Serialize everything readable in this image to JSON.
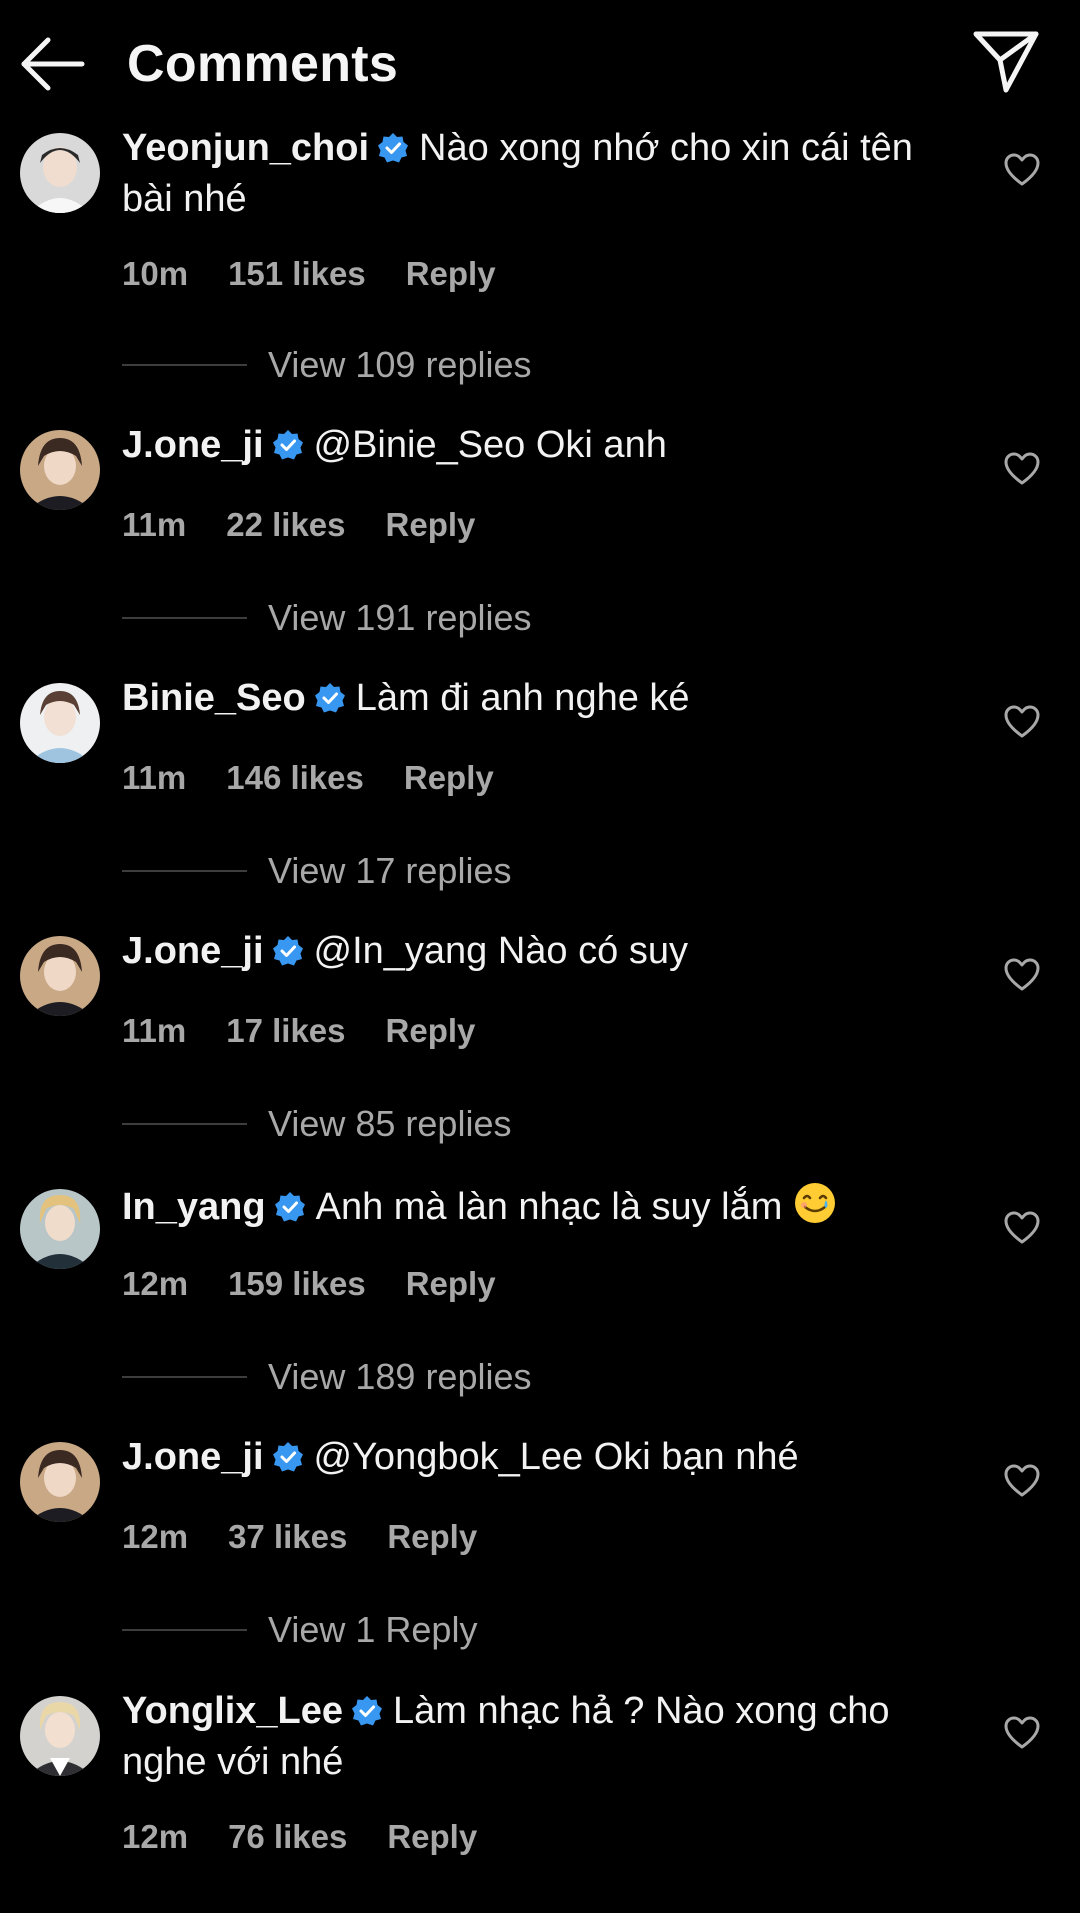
{
  "header": {
    "title": "Comments"
  },
  "colors": {
    "background": "#000000",
    "verified": "#3897f0",
    "muted": "#a8a8a8",
    "text": "#f5f5f5"
  },
  "comments": [
    {
      "username": "Yeonjun_choi",
      "text": "Nào xong nhớ cho xin cái tên bài nhé",
      "time": "10m",
      "likes": "151 likes",
      "reply": "Reply",
      "view_replies": "View 109 replies",
      "avatar_icon": "avatar-yeonjun"
    },
    {
      "username": "J.one_ji",
      "text": "@Binie_Seo Oki anh",
      "time": "11m",
      "likes": "22 likes",
      "reply": "Reply",
      "view_replies": "View 191 replies",
      "avatar_icon": "avatar-jone"
    },
    {
      "username": "Binie_Seo",
      "text": "Làm đi anh nghe ké",
      "time": "11m",
      "likes": "146 likes",
      "reply": "Reply",
      "view_replies": "View 17 replies",
      "avatar_icon": "avatar-binie"
    },
    {
      "username": "J.one_ji",
      "text": "@In_yang Nào có suy",
      "time": "11m",
      "likes": "17 likes",
      "reply": "Reply",
      "view_replies": "View 85 replies",
      "avatar_icon": "avatar-jone"
    },
    {
      "username": "In_yang",
      "text": "Anh mà làn nhạc là suy lắm",
      "time": "12m",
      "likes": "159 likes",
      "reply": "Reply",
      "view_replies": "View 189 replies",
      "avatar_icon": "avatar-inyang",
      "emoji": "smiling-face-with-tear"
    },
    {
      "username": "J.one_ji",
      "text": "@Yongbok_Lee Oki bạn nhé",
      "time": "12m",
      "likes": "37 likes",
      "reply": "Reply",
      "view_replies": "View 1 Reply",
      "avatar_icon": "avatar-jone"
    },
    {
      "username": "Yonglix_Lee",
      "text": "Làm nhạc hả ? Nào xong cho nghe với nhé",
      "time": "12m",
      "likes": "76 likes",
      "reply": "Reply",
      "avatar_icon": "avatar-yonglix"
    }
  ]
}
